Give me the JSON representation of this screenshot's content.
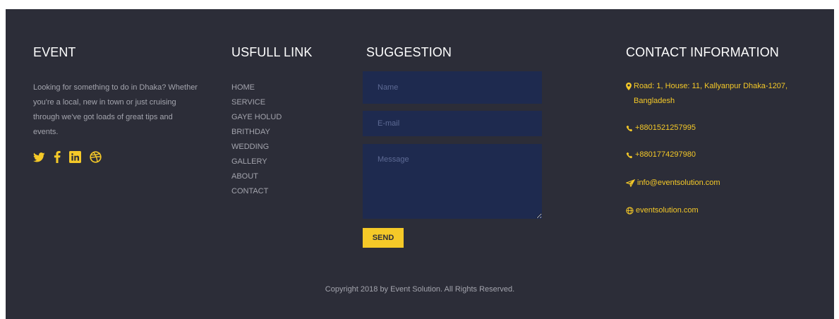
{
  "event": {
    "heading": "EVENT",
    "description": "Looking for something to do in Dhaka? Whether you're a local, new in town or just cruising through we've got loads of great tips and events.",
    "social_icons": [
      "twitter-icon",
      "facebook-icon",
      "linkedin-icon",
      "dribbble-icon"
    ],
    "accent_color": "#f5c928"
  },
  "links": {
    "heading": "USFULL LINK",
    "items": [
      "HOME",
      "SERVICE",
      "GAYE HOLUD",
      "BRITHDAY",
      "WEDDING",
      "GALLERY",
      "ABOUT",
      "CONTACT"
    ]
  },
  "suggestion": {
    "heading": "SUGGESTION",
    "name_placeholder": "Name",
    "email_placeholder": "E-mail",
    "message_placeholder": "Message",
    "send_label": "SEND"
  },
  "contact": {
    "heading": "CONTACT INFORMATION",
    "address": "Road: 1, House: 11, Kallyanpur Dhaka-1207, Bangladesh",
    "phone1": "+8801521257995",
    "phone2": "+8801774297980",
    "email": "info@eventsolution.com",
    "website": "eventsolution.com"
  },
  "footer": {
    "copyright": "Copyright 2018 by Event Solution. All Rights Reserved."
  },
  "colors": {
    "background": "#2c2d38",
    "input_bg": "#1e2a4f",
    "text_muted": "#a3a4ad"
  }
}
